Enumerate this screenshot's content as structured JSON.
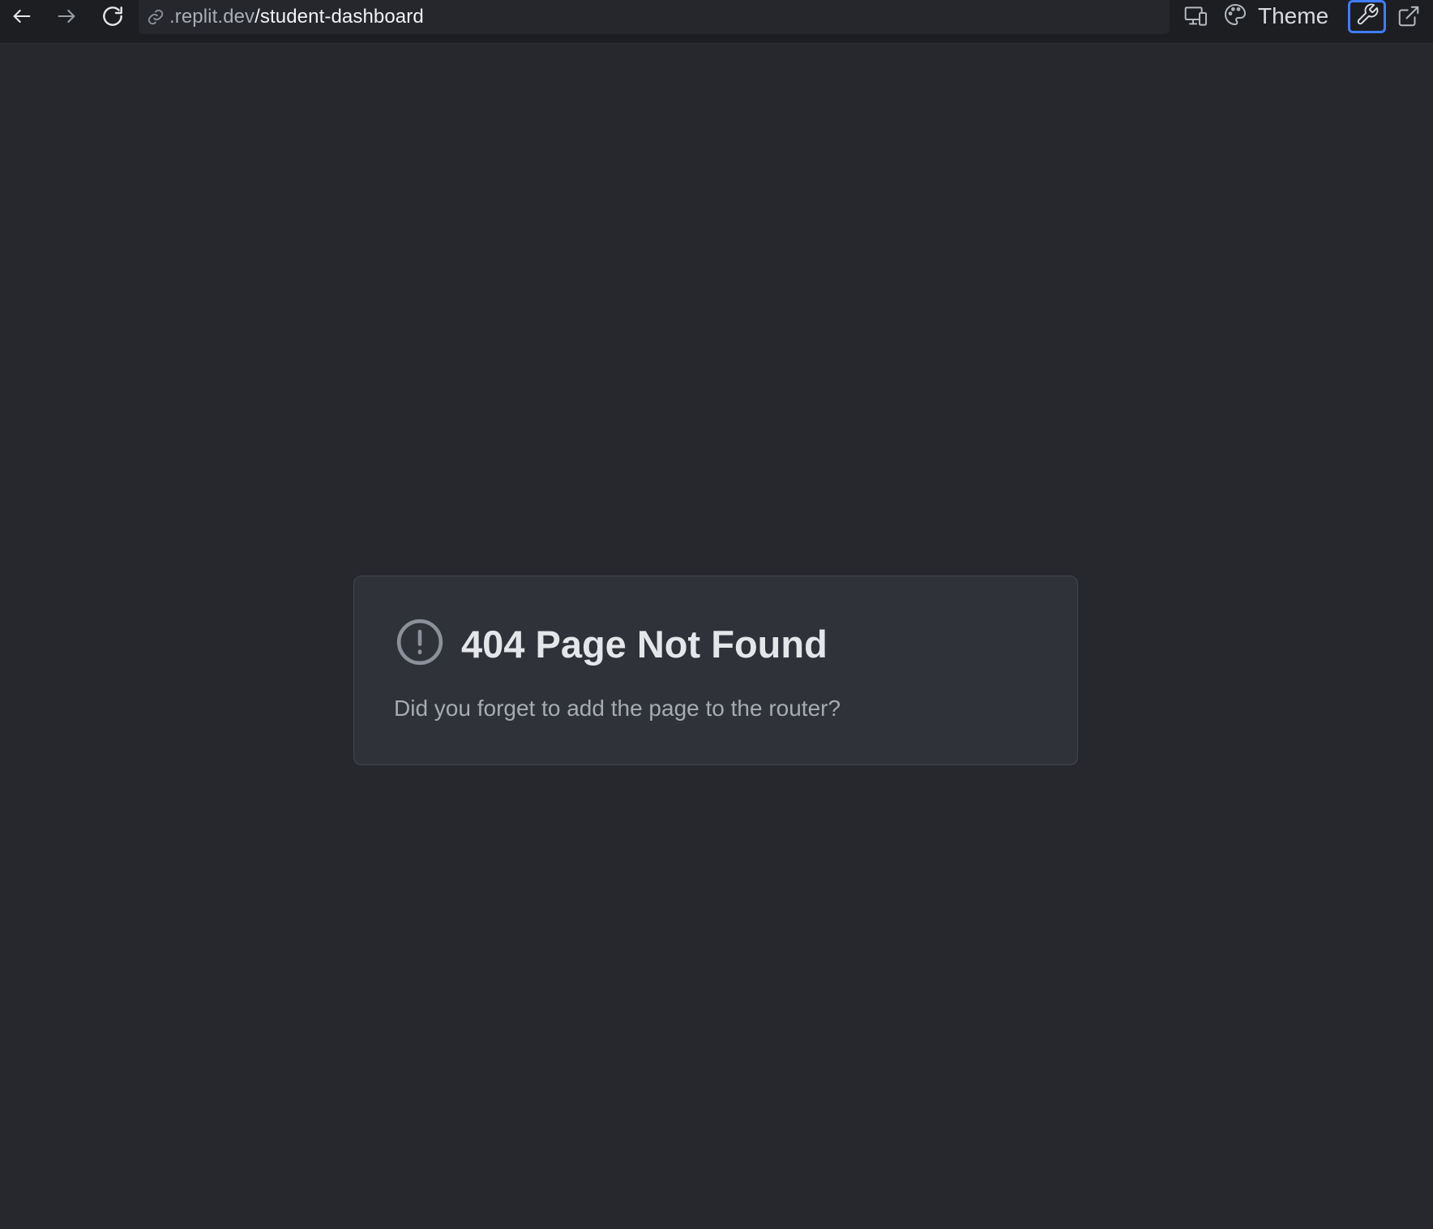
{
  "toolbar": {
    "url_host": ".replit.dev",
    "url_path": "/student-dashboard",
    "theme_label": "Theme",
    "icons": [
      "arrow-left-icon",
      "arrow-right-icon",
      "refresh-icon",
      "link-icon",
      "devices-icon",
      "palette-icon",
      "wrench-icon",
      "external-link-icon"
    ]
  },
  "content": {
    "title": "404 Page Not Found",
    "message": "Did you forget to add the page to the router?",
    "icon": "alert-circle-icon"
  },
  "colors": {
    "background": "#26282d",
    "card": "#2f3238",
    "accent": "#3f7dfa"
  }
}
